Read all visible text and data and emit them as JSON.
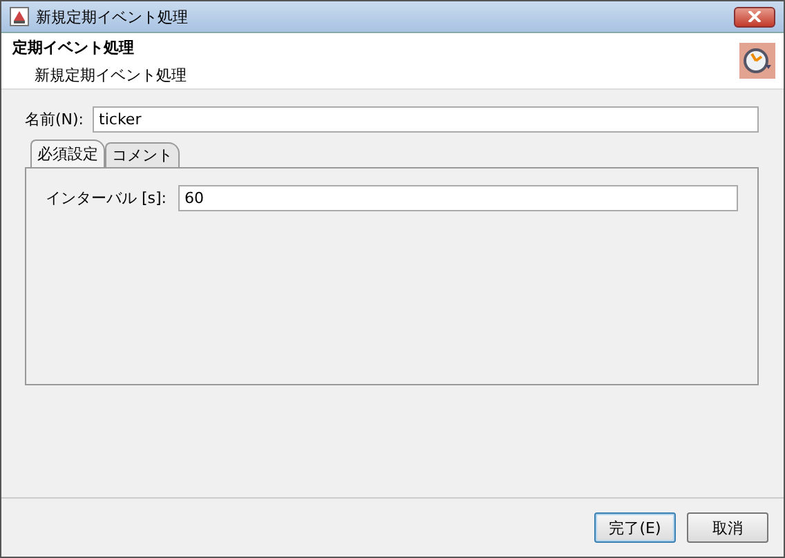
{
  "window": {
    "title": "新規定期イベント処理"
  },
  "header": {
    "title": "定期イベント処理",
    "subtitle": "新規定期イベント処理"
  },
  "name_field": {
    "label": "名前(N):",
    "value": "ticker"
  },
  "tabs": [
    {
      "label": "必須設定",
      "selected": true
    },
    {
      "label": "コメント",
      "selected": false
    }
  ],
  "interval_field": {
    "label": "インターバル [s]:",
    "value": "60"
  },
  "buttons": [
    "完了(E)",
    "取消"
  ]
}
